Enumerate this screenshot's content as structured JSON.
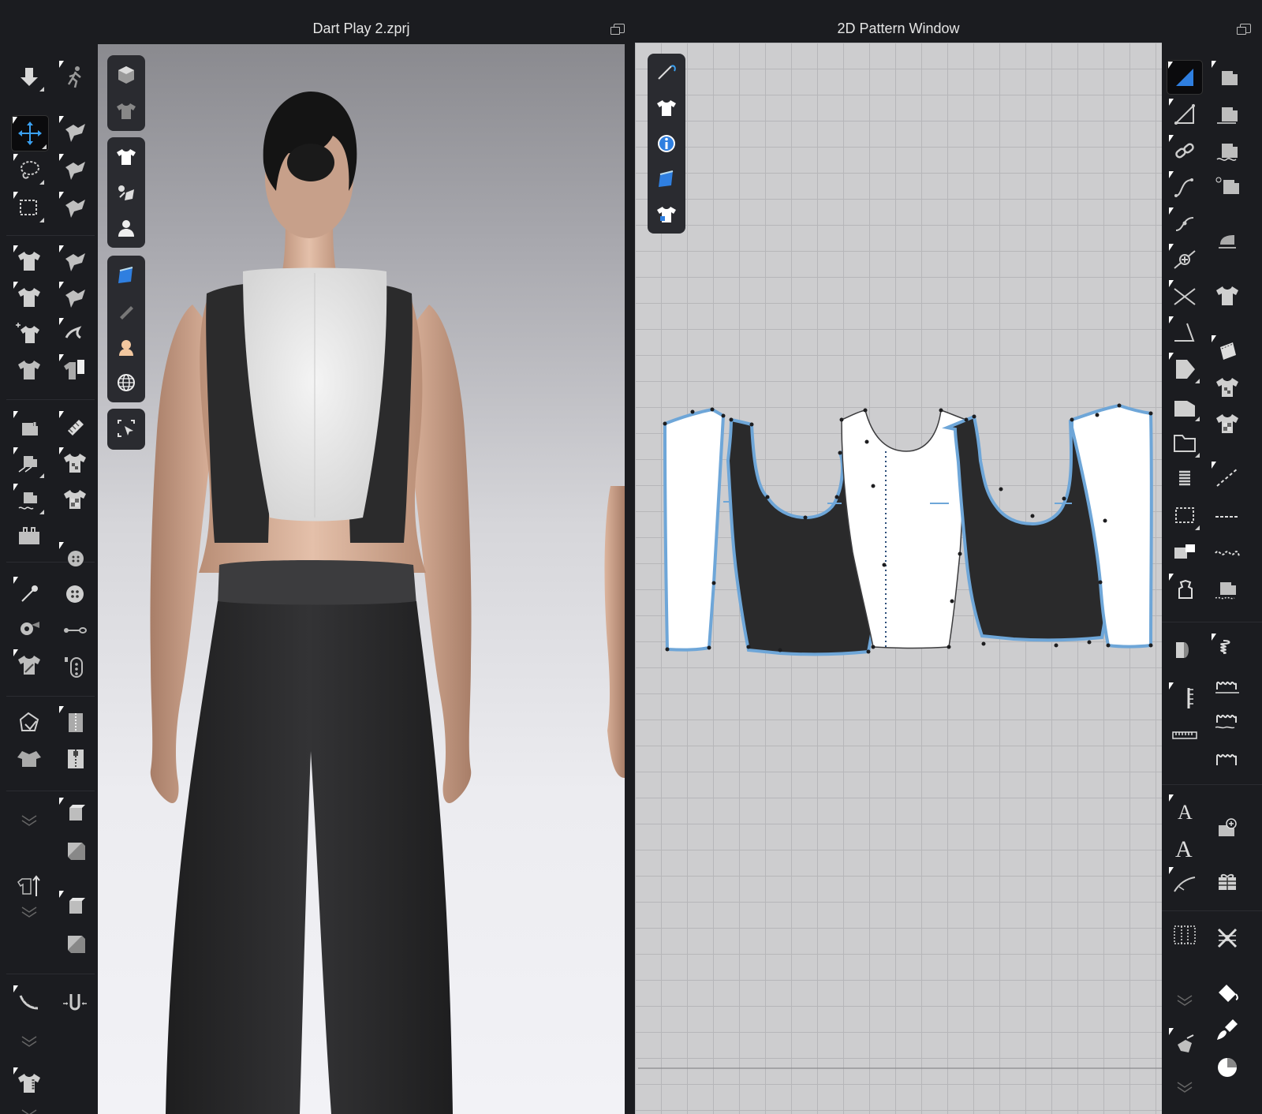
{
  "left_panel": {
    "title": "Dart Play 2.zprj"
  },
  "right_panel": {
    "title": "2D Pattern Window"
  },
  "left_toolbar_icons": [
    "arrow-down-icon",
    "walk-icon",
    "move-icon",
    "fold-icon",
    "lasso-icon",
    "fold-2-icon",
    "marquee-icon",
    "fold-3-icon",
    "shirt-fit-icon",
    "fold-4-icon",
    "shirt-icon",
    "fold-5-icon",
    "shirt-move-icon",
    "fold-6-icon",
    "shirt-dark-icon",
    "shirt-split-icon",
    "sew-icon",
    "pattern-sew-icon",
    "sew-2-icon",
    "shirt-check-icon",
    "sew-3-icon",
    "shirt-check-2-icon",
    "tailor-icon",
    "button-icon",
    "pin-icon",
    "button-2-icon",
    "tape-icon",
    "zipper-icon",
    "shirt-lock-icon",
    "zipper-2-icon",
    "import-icon",
    "zipper-3-icon",
    "jacket-icon",
    "zipper-4-icon",
    "expand-icon",
    "box-icon",
    "box-2-icon",
    "shirt-up-icon",
    "box-3-icon",
    "expand-2-icon",
    "box-4-icon",
    "measure-icon",
    "expand-3-icon",
    "arrows-in-icon",
    "shirt-tag-icon",
    "expand-4-icon"
  ],
  "viewport3d_bar": [
    "cube-icon",
    "shirt-outline-icon",
    "shirt-icon",
    "fabric-icon",
    "avatar-icon",
    "texture-icon",
    "pencil-icon",
    "face-icon",
    "globe-icon",
    "select-icon"
  ],
  "viewport2d_bar": [
    "needle-icon",
    "shirt-icon",
    "info-icon",
    "texture-icon",
    "shirt-lock-icon"
  ],
  "right_toolbar_icons": [
    "select-triangle-icon",
    "pattern-edit-icon",
    "segment-icon",
    "pattern-2-icon",
    "link-icon",
    "pattern-3-icon",
    "curve-icon",
    "pattern-4-icon",
    "curve-2-icon",
    "iron-icon",
    "add-point-icon",
    "shirt-icon",
    "cut-icon",
    "fabric-icon",
    "measure-angle-icon",
    "shirt-check-icon",
    "shape-icon",
    "shirt-check-2-icon",
    "polygon-icon",
    "dashed-line-icon",
    "folder-icon",
    "dashed-line-2-icon",
    "spring-icon",
    "wave-icon",
    "marquee-icon",
    "sew-icon",
    "badge-icon",
    "pattern-5-icon",
    "shirt-flag-icon",
    "spring-2-icon",
    "pattern-6-icon",
    "stitch-icon",
    "ruler-icon",
    "stitch-2-icon",
    "ruler-2-icon",
    "stitch-3-icon",
    "text-icon",
    "sew-add-icon",
    "text-2-icon",
    "gift-icon",
    "curve-3-icon",
    "lace-icon",
    "grid-icon",
    "paint-bucket-icon",
    "expand-icon",
    "brush-icon",
    "arrange-icon",
    "pie-icon",
    "expand-2-icon"
  ]
}
